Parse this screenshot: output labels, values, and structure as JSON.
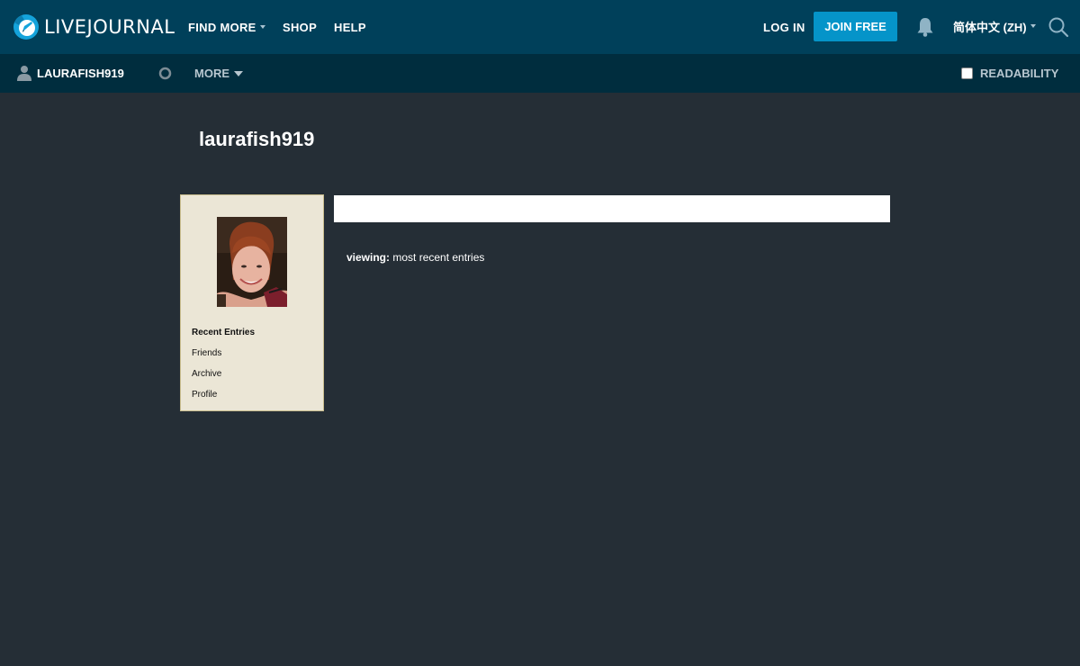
{
  "header": {
    "logo_text": "LIVEJOURNAL",
    "nav": [
      {
        "label": "FIND MORE",
        "has_dropdown": true
      },
      {
        "label": "SHOP",
        "has_dropdown": false
      },
      {
        "label": "HELP",
        "has_dropdown": false
      }
    ],
    "login_label": "LOG IN",
    "join_label": "JOIN FREE",
    "language_label": "简体中文 (ZH)",
    "icons": [
      "livejournal-logo-icon",
      "bell-icon",
      "search-icon"
    ]
  },
  "subheader": {
    "username": "LAURAFISH919",
    "more_label": "MORE",
    "readability_label": "READABILITY",
    "readability_checked": false,
    "icons": [
      "user-icon",
      "ring-icon",
      "chevron-down-icon"
    ]
  },
  "journal": {
    "title": "laurafish919",
    "sidebar": {
      "links": [
        {
          "label": "Recent Entries",
          "active": true
        },
        {
          "label": "Friends",
          "active": false
        },
        {
          "label": "Archive",
          "active": false
        },
        {
          "label": "Profile",
          "active": false
        }
      ]
    },
    "viewing_label": "viewing:",
    "viewing_value": "most recent entries"
  },
  "colors": {
    "topbar": "#00405a",
    "subbar": "#002d3e",
    "page_background": "#252e36",
    "join_button": "#0594c9",
    "sidebar_background": "#ebe6d6"
  }
}
